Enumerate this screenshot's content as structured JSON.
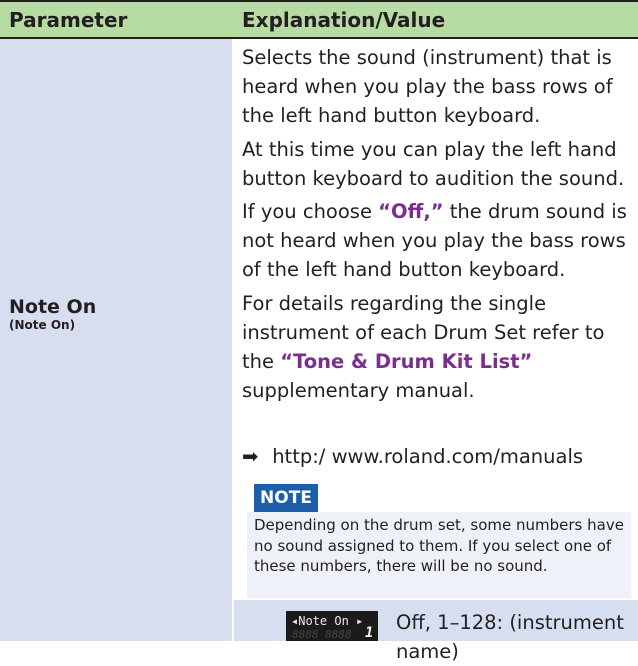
{
  "header": {
    "parameter": "Parameter",
    "explanation": "Explanation/Value"
  },
  "row": {
    "name": "Note On",
    "sub": "(Note On)",
    "paragraphs": [
      "Selects the sound (instrument) that is heard when you play the bass rows of the left hand button keyboard.",
      "At this time you can play the left hand button keyboard to audition the sound."
    ],
    "off_para": {
      "before": "If you choose ",
      "highlight": "“Off,”",
      "after": " the drum sound is not heard when you play the bass rows of the left hand button keyboard."
    },
    "details_para": {
      "before": "For details regarding the single instrument of each Drum Set refer to the ",
      "highlight": "“Tone & Drum Kit List”",
      "after": " supplementary manual."
    },
    "link": {
      "arrow": "➡",
      "url": "http:/ www.roland.com/manuals"
    },
    "note": {
      "tag": "NOTE",
      "text": "Depending on the drum set, some numbers have no sound assigned to them. If you select one of these numbers, there will be no sound."
    },
    "lcd": {
      "title": "◂Note On ▸",
      "value": "1"
    },
    "value_range": "Off, 1–128: (instrument name)"
  }
}
